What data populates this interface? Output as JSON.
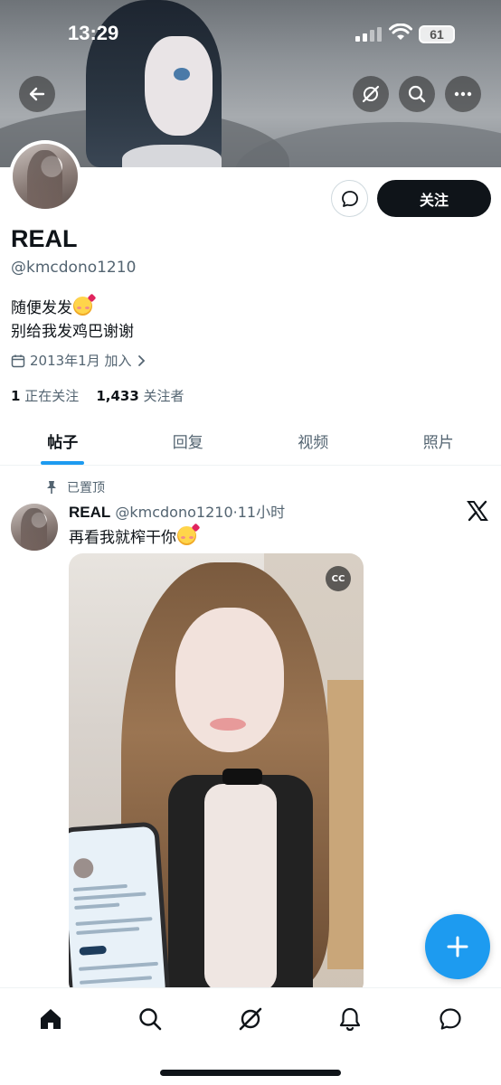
{
  "status_bar": {
    "time": "13:29",
    "battery": "61"
  },
  "header": {
    "back_icon": "arrow-left-icon",
    "grok_icon": "grok-icon",
    "search_icon": "search-icon",
    "more_icon": "more-horizontal-icon"
  },
  "profile": {
    "display_name": "REAL",
    "handle": "@kmcdono1210",
    "bio_line1": "随便发发",
    "bio_line2": "别给我发鸡巴谢谢",
    "joined": "2013年1月 加入",
    "following_count": "1",
    "following_label": "正在关注",
    "followers_count": "1,433",
    "followers_label": "关注者",
    "follow_button": "关注"
  },
  "tabs": [
    {
      "label": "帖子",
      "active": true
    },
    {
      "label": "回复",
      "active": false
    },
    {
      "label": "视频",
      "active": false
    },
    {
      "label": "照片",
      "active": false
    }
  ],
  "post": {
    "pinned_label": "已置顶",
    "author_name": "REAL",
    "author_handle": "@kmcdono1210",
    "separator": "·",
    "time_ago": "11小时",
    "text": "再看我就榨干你",
    "captions_badge": "CC"
  },
  "bottom_nav": [
    "home-icon",
    "search-icon",
    "grok-icon",
    "notifications-icon",
    "messages-icon"
  ],
  "colors": {
    "accent": "#1d9bf0",
    "text": "#0f1419",
    "secondary": "#536471",
    "follow_bg": "#0f1419"
  }
}
